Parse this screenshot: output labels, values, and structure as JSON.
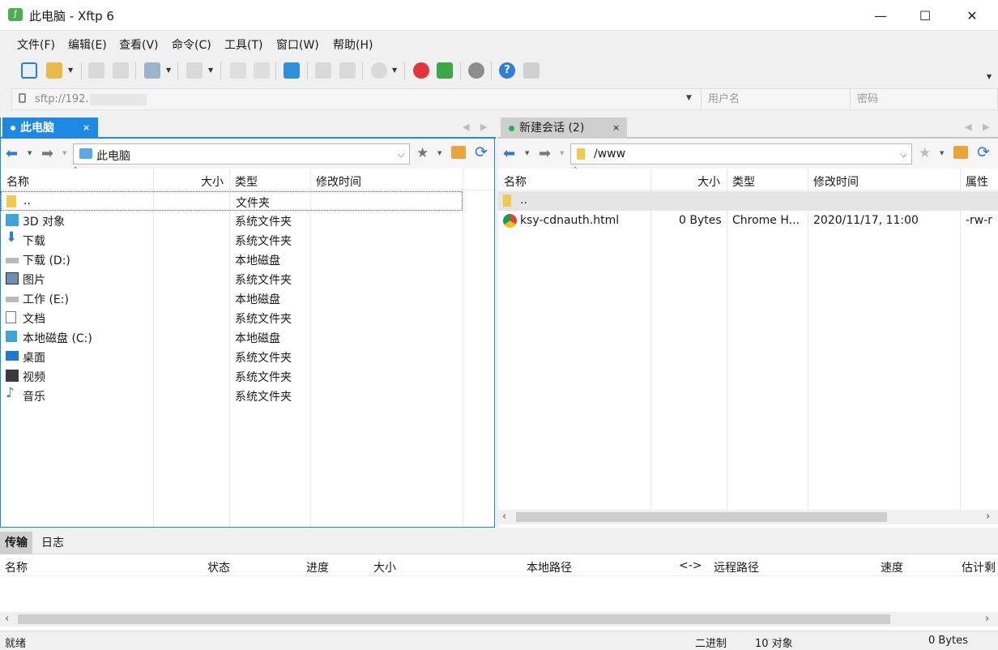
{
  "window": {
    "title": "此电脑 - Xftp 6",
    "minimize": "—",
    "maximize": "☐",
    "close": "✕"
  },
  "menu": [
    "文件(F)",
    "编辑(E)",
    "查看(V)",
    "命令(C)",
    "工具(T)",
    "窗口(W)",
    "帮助(H)"
  ],
  "address": {
    "url": "sftp://192.",
    "username_placeholder": "用户名",
    "password_placeholder": "密码"
  },
  "left_panel": {
    "tab_label": "此电脑",
    "tab_close": "×",
    "path": "此电脑",
    "columns": [
      "名称",
      "大小",
      "类型",
      "修改时间"
    ],
    "rows": [
      {
        "name": "..",
        "type": "文件夹",
        "icon": "folder-icon"
      },
      {
        "name": "3D 对象",
        "type": "系统文件夹",
        "icon": "3d-objects-icon"
      },
      {
        "name": "下载",
        "type": "系统文件夹",
        "icon": "download-icon"
      },
      {
        "name": "下载 (D:)",
        "type": "本地磁盘",
        "icon": "drive-icon"
      },
      {
        "name": "图片",
        "type": "系统文件夹",
        "icon": "pictures-icon"
      },
      {
        "name": "工作 (E:)",
        "type": "本地磁盘",
        "icon": "drive-icon"
      },
      {
        "name": "文档",
        "type": "系统文件夹",
        "icon": "documents-icon"
      },
      {
        "name": "本地磁盘 (C:)",
        "type": "本地磁盘",
        "icon": "windows-drive-icon"
      },
      {
        "name": "桌面",
        "type": "系统文件夹",
        "icon": "desktop-icon"
      },
      {
        "name": "视频",
        "type": "系统文件夹",
        "icon": "videos-icon"
      },
      {
        "name": "音乐",
        "type": "系统文件夹",
        "icon": "music-icon"
      }
    ]
  },
  "right_panel": {
    "tab_label": "新建会话 (2)",
    "tab_close": "×",
    "path": "/www",
    "columns": [
      "名称",
      "大小",
      "类型",
      "修改时间",
      "属性"
    ],
    "rows": [
      {
        "name": "..",
        "size": "",
        "type": "",
        "modified": "",
        "attr": "",
        "icon": "folder-icon"
      },
      {
        "name": "ksy-cdnauth.html",
        "size": "0 Bytes",
        "type": "Chrome H...",
        "modified": "2020/11/17, 11:00",
        "attr": "-rw-r",
        "icon": "chrome-icon"
      }
    ]
  },
  "transfer": {
    "tabs": [
      "传输",
      "日志"
    ],
    "columns": [
      "名称",
      "状态",
      "进度",
      "大小",
      "本地路径",
      "<->",
      "远程路径",
      "速度",
      "估计剩"
    ]
  },
  "status": {
    "ready": "就绪",
    "mode": "二进制",
    "count": "10 对象",
    "size": "0 Bytes"
  },
  "colors": {
    "accent": "#1e88e5",
    "session_dot": "#22b14c"
  }
}
